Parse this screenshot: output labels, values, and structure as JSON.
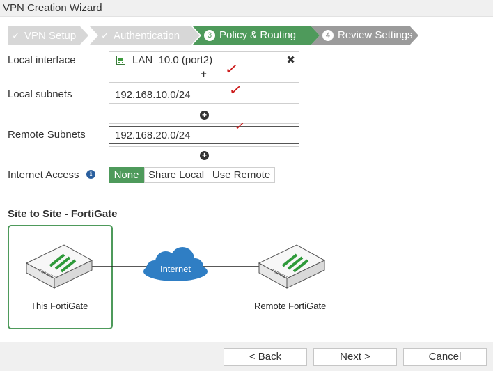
{
  "window": {
    "title": "VPN Creation Wizard"
  },
  "wizard": {
    "steps": [
      {
        "label": "VPN Setup",
        "state": "done",
        "marker": "✓"
      },
      {
        "label": "Authentication",
        "state": "done",
        "marker": "✓"
      },
      {
        "label": "Policy & Routing",
        "state": "active",
        "marker": "3"
      },
      {
        "label": "Review Settings",
        "state": "todo",
        "marker": "4"
      }
    ]
  },
  "form": {
    "local_interface": {
      "label": "Local interface",
      "value": "LAN_10.0 (port2)",
      "add_symbol": "+",
      "remove_symbol": "✖"
    },
    "local_subnets": {
      "label": "Local subnets",
      "value": "192.168.10.0/24"
    },
    "remote_subnets": {
      "label": "Remote Subnets",
      "value": "192.168.20.0/24"
    },
    "internet_access": {
      "label": "Internet Access",
      "info_symbol": "i",
      "options": [
        "None",
        "Share Local",
        "Use Remote"
      ],
      "selected": "None"
    },
    "add_symbol": "+"
  },
  "annotations": {
    "checkmark": "✓"
  },
  "diagram": {
    "title": "Site to Site - FortiGate",
    "local_label": "This FortiGate",
    "remote_label": "Remote FortiGate",
    "cloud_label": "Internet",
    "device_brand": "FORTINET",
    "colors": {
      "accent": "#4e9a5b",
      "cloud": "#2f7ec4",
      "device_green": "#2e9a3a"
    }
  },
  "footer": {
    "back_label": "< Back",
    "next_label": "Next >",
    "cancel_label": "Cancel"
  }
}
